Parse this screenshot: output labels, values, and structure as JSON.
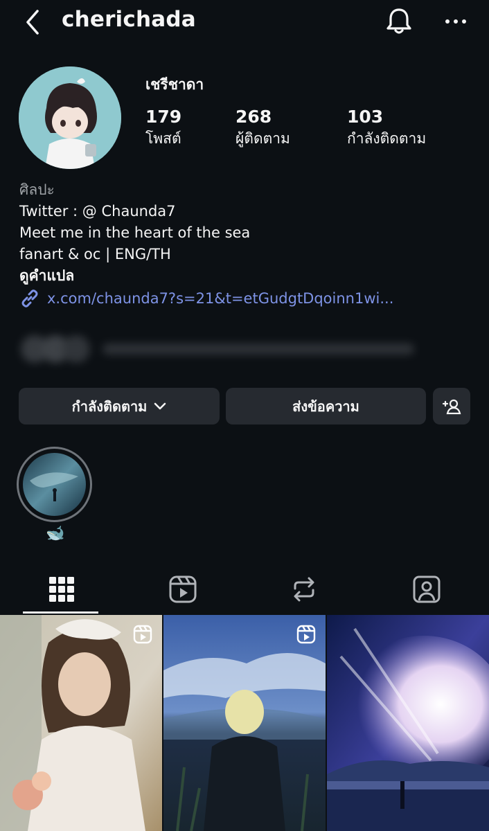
{
  "header": {
    "username": "cherichada",
    "back_icon": "chevron-left-icon",
    "notification_icon": "bell-icon",
    "more_icon": "more-horizontal-icon"
  },
  "profile": {
    "full_name": "เชรีชาดา",
    "stats": [
      {
        "value": "179",
        "label": "โพสต์"
      },
      {
        "value": "268",
        "label": "ผู้ติดตาม"
      },
      {
        "value": "103",
        "label": "กำลังติดตาม"
      }
    ],
    "category": "ศิลปะ",
    "bio_lines": [
      "Twitter : @ Chaunda7",
      "Meet me in the heart of the sea",
      "fanart & oc | ENG/TH"
    ],
    "translate_label": "ดูคำแปล",
    "link": "x.com/chaunda7?s=21&t=etGudgtDqoinn1wi..."
  },
  "actions": {
    "following_label": "กำลังติดตาม",
    "message_label": "ส่งข้อความ",
    "add_user_icon": "add-user-icon"
  },
  "highlights": [
    {
      "label": "🐋"
    }
  ],
  "tabs": [
    {
      "name": "posts",
      "icon": "grid-icon",
      "active": true
    },
    {
      "name": "reels",
      "icon": "reels-icon",
      "active": false
    },
    {
      "name": "reposts",
      "icon": "repost-icon",
      "active": false
    },
    {
      "name": "tagged",
      "icon": "tagged-user-icon",
      "active": false
    }
  ],
  "posts": [
    {
      "type": "reel"
    },
    {
      "type": "reel"
    },
    {
      "type": "image"
    }
  ],
  "colors": {
    "background": "#0c1014",
    "button": "#262a30",
    "link": "#7e93e6",
    "muted_text": "#a0a4a8"
  }
}
